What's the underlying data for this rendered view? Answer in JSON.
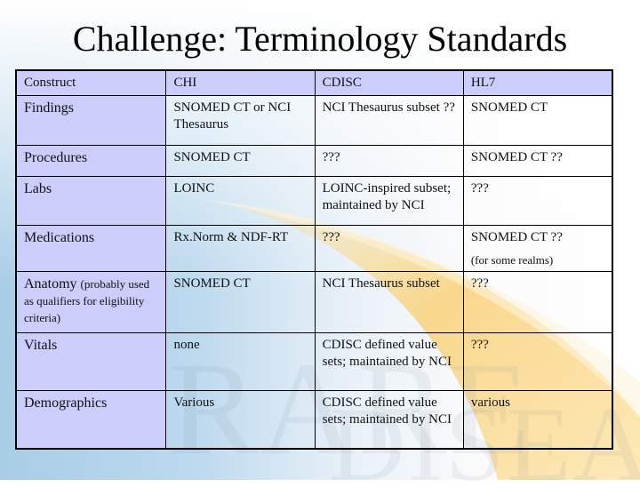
{
  "slide": {
    "title": "Challenge: Terminology Standards",
    "watermark": [
      "RARE",
      "DISEASES"
    ]
  },
  "table": {
    "headers": [
      "Construct",
      "CHI",
      "CDISC",
      "HL7"
    ],
    "rows": [
      {
        "construct": "Findings",
        "construct_note": "",
        "chi": "SNOMED CT or NCI Thesaurus",
        "cdisc": "NCI Thesaurus subset ??",
        "hl7": "SNOMED CT",
        "hl7_note": ""
      },
      {
        "construct": "Procedures",
        "construct_note": "",
        "chi": "SNOMED CT",
        "cdisc": "???",
        "hl7": "SNOMED CT ??",
        "hl7_note": ""
      },
      {
        "construct": "Labs",
        "construct_note": "",
        "chi": "LOINC",
        "cdisc": "LOINC-inspired subset; maintained by NCI",
        "hl7": "???",
        "hl7_note": ""
      },
      {
        "construct": "Medications",
        "construct_note": "",
        "chi": "Rx.Norm & NDF-RT",
        "cdisc": "???",
        "hl7": "SNOMED CT ??",
        "hl7_note": "(for some realms)"
      },
      {
        "construct": "Anatomy",
        "construct_note": "(probably used as qualifiers for eligibility criteria)",
        "chi": "SNOMED CT",
        "cdisc": "NCI Thesaurus subset",
        "hl7": "???",
        "hl7_note": ""
      },
      {
        "construct": "Vitals",
        "construct_note": "",
        "chi": "none",
        "cdisc": "CDISC defined value sets; maintained by NCI",
        "hl7": "???",
        "hl7_note": ""
      },
      {
        "construct": "Demographics",
        "construct_note": "",
        "chi": "Various",
        "cdisc": "CDISC defined value sets; maintained by NCI",
        "hl7": "various",
        "hl7_note": ""
      }
    ]
  },
  "colors": {
    "header_bg": "#cccdfa",
    "first_col_bg": "#cccdfa",
    "swoosh": "#f7c24a",
    "bg_blue": "#a8cde6"
  }
}
